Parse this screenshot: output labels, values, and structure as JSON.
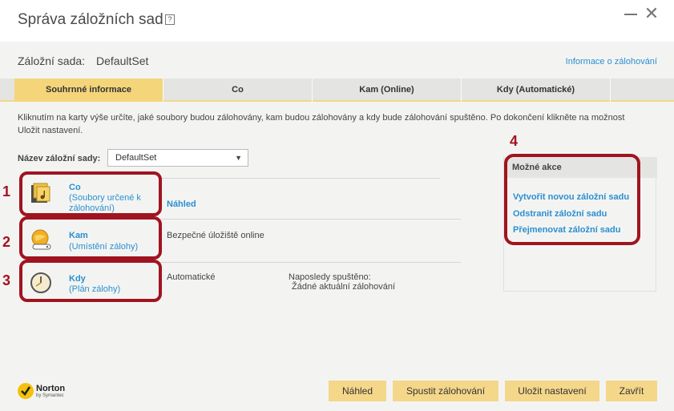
{
  "window": {
    "title": "Správa záložních sad",
    "help_label": "?",
    "close_label": "✕"
  },
  "setbar": {
    "label": "Záložní sada:",
    "name": "DefaultSet",
    "info_link": "Informace o zálohování"
  },
  "tabs": [
    {
      "label": "Souhrnné informace",
      "active": true
    },
    {
      "label": "Co",
      "active": false
    },
    {
      "label": "Kam (Online)",
      "active": false
    },
    {
      "label": "Kdy (Automatické)",
      "active": false
    }
  ],
  "description": "Kliknutím na karty výše určíte, jaké soubory budou zálohovány, kam budou zálohovány a kdy bude zálohování spuštěno. Po dokončení klikněte na možnost Uložit nastavení.",
  "backup_set_field": {
    "label": "Název záložní sady:",
    "selected": "DefaultSet"
  },
  "rows": [
    {
      "number": "1",
      "title": "Co",
      "subtitle": "(Soubory určené k zálohování)",
      "link": "Náhled",
      "icon": "files-icon"
    },
    {
      "number": "2",
      "title": "Kam",
      "subtitle": "(Umístění zálohy)",
      "value": "Bezpečné úložiště online",
      "icon": "online-storage-icon"
    },
    {
      "number": "3",
      "title": "Kdy",
      "subtitle": "(Plán zálohy)",
      "value": "Automatické",
      "last_run_label": "Naposledy spuštěno:",
      "last_run_value": "Žádné aktuální zálohování",
      "icon": "clock-icon"
    }
  ],
  "actions": {
    "number": "4",
    "header": "Možné akce",
    "items": [
      "Vytvořit novou záložní sadu",
      "Odstranit záložní sadu",
      "Přejmenovat záložní sadu"
    ]
  },
  "logo": {
    "brand": "Norton",
    "sub": "by Symantec"
  },
  "buttons": {
    "preview": "Náhled",
    "run_backup": "Spustit zálohování",
    "save_settings": "Uložit nastavení",
    "close": "Zavřít"
  },
  "colors": {
    "accent": "#f5d57a",
    "link": "#2b8fd0",
    "highlight": "#a01420"
  }
}
